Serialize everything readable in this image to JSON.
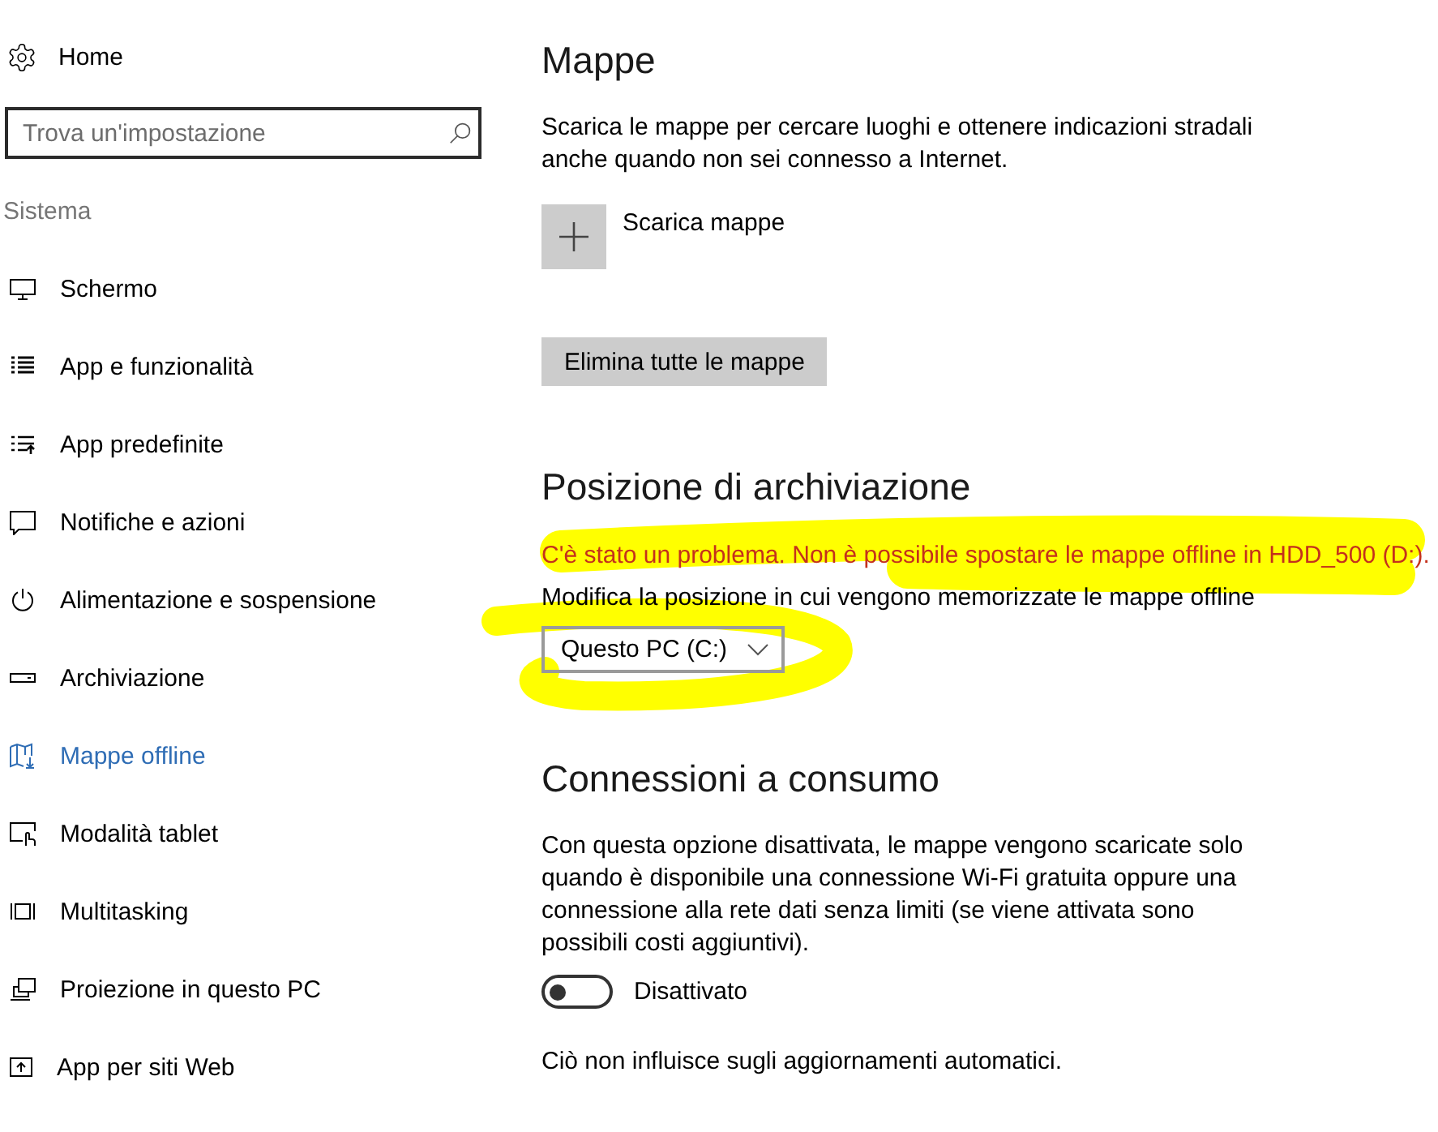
{
  "sidebar": {
    "home": {
      "label": "Home"
    },
    "search": {
      "placeholder": "Trova un'impostazione"
    },
    "section": "Sistema",
    "items": [
      {
        "label": "Schermo",
        "selected": false
      },
      {
        "label": "App e funzionalità",
        "selected": false
      },
      {
        "label": "App predefinite",
        "selected": false
      },
      {
        "label": "Notifiche e azioni",
        "selected": false
      },
      {
        "label": "Alimentazione e sospensione",
        "selected": false
      },
      {
        "label": "Archiviazione",
        "selected": false
      },
      {
        "label": "Mappe offline",
        "selected": true
      },
      {
        "label": "Modalità tablet",
        "selected": false
      },
      {
        "label": "Multitasking",
        "selected": false
      },
      {
        "label": "Proiezione in questo PC",
        "selected": false
      },
      {
        "label": "App per siti Web",
        "selected": false
      }
    ]
  },
  "maps": {
    "title": "Mappe",
    "description": "Scarica le mappe per cercare luoghi e ottenere indicazioni stradali anche quando non sei connesso a Internet.",
    "download_button": "Scarica mappe",
    "delete_button": "Elimina tutte le mappe"
  },
  "storage": {
    "title": "Posizione di archiviazione",
    "error": "C'è stato un problema. Non è possibile spostare le mappe offline in HDD_500 (D:).",
    "label": "Modifica la posizione in cui vengono memorizzate le mappe offline",
    "dropdown": {
      "value": "Questo PC (C:)"
    }
  },
  "metered": {
    "title": "Connessioni a consumo",
    "description": "Con questa opzione disattivata, le mappe vengono scaricate solo quando è disponibile una connessione Wi-Fi gratuita oppure una connessione alla rete dati senza limiti (se viene attivata sono possibili costi aggiuntivi).",
    "toggle": {
      "on": false,
      "label": "Disattivato"
    },
    "note": "Ciò non influisce sugli aggiornamenti automatici."
  }
}
